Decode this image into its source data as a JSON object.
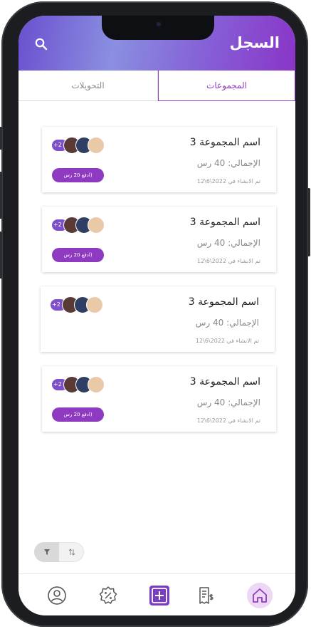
{
  "header": {
    "title": "السجل",
    "search_icon": "search-icon"
  },
  "tabs": [
    {
      "label": "التحويلات",
      "active": false
    },
    {
      "label": "المجموعات",
      "active": true
    }
  ],
  "groups": [
    {
      "name": "اسم المجموعة 3",
      "total": "الإجمالي: 40 رس",
      "date": "تم الانشاء في 2022\\6\\12",
      "more_members": "+2",
      "pay_label": "ادفع 20 رس)"
    },
    {
      "name": "اسم المجموعة 3",
      "total": "الإجمالي: 40 رس",
      "date": "تم الانشاء في 2022\\6\\12",
      "more_members": "+2",
      "pay_label": "ادفع 20 رس)"
    },
    {
      "name": "اسم المجموعة 3",
      "total": "الإجمالي: 40 رس",
      "date": "تم الانشاء في 2022\\6\\12",
      "more_members": "+2",
      "pay_label": ""
    },
    {
      "name": "اسم المجموعة 3",
      "total": "الإجمالي: 40 رس",
      "date": "تم الانشاء في 2022\\6\\12",
      "more_members": "+2",
      "pay_label": "ادفع 20 رس)"
    }
  ],
  "filter_toggle": {
    "left_icon": "filter-icon",
    "right_icon": "sort-icon"
  },
  "bottom_nav": [
    "profile-icon",
    "discount-icon",
    "add-icon",
    "invoice-icon",
    "home-icon"
  ],
  "colors": {
    "accent": "#8f3bc1",
    "header_start": "#6b4fd0",
    "header_end": "#8a35c8"
  }
}
